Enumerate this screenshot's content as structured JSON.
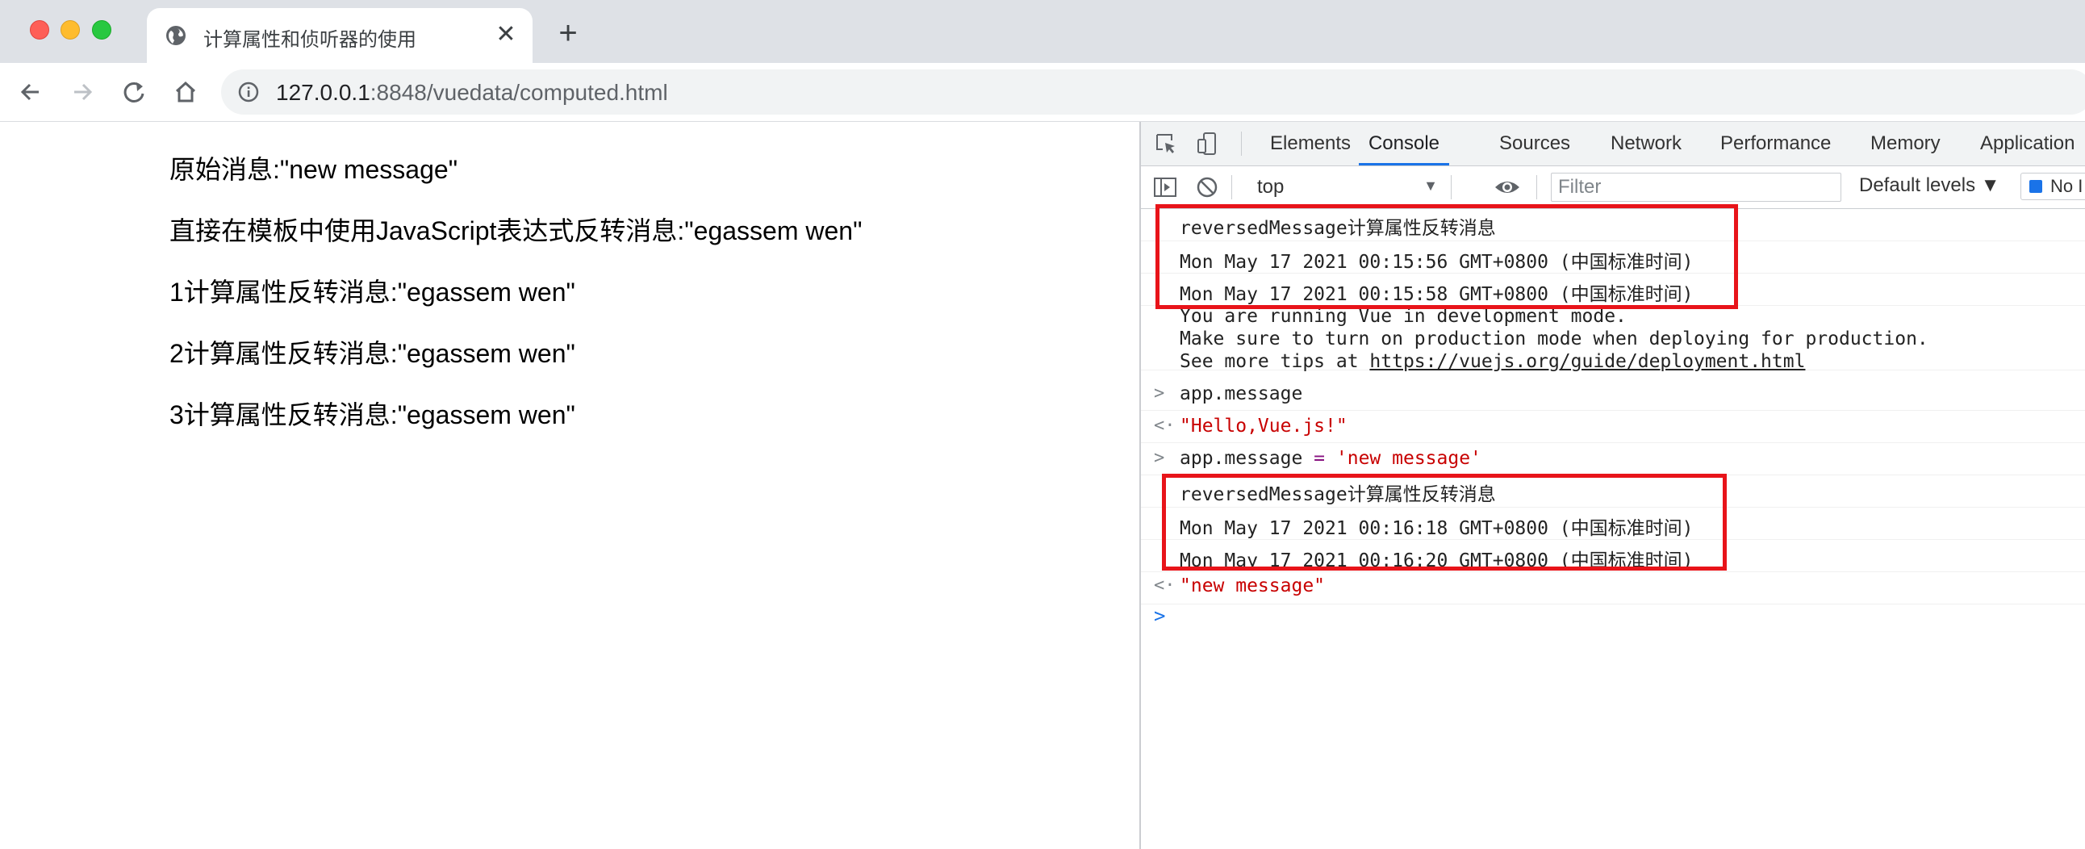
{
  "browser": {
    "tab_title": "计算属性和侦听器的使用",
    "close_glyph": "✕",
    "new_tab_glyph": "+",
    "url_host": "127.0.0.1",
    "url_rest": ":8848/vuedata/computed.html"
  },
  "page": {
    "lines": [
      "原始消息:\"new message\"",
      "直接在模板中使用JavaScript表达式反转消息:\"egassem wen\"",
      "1计算属性反转消息:\"egassem wen\"",
      "2计算属性反转消息:\"egassem wen\"",
      "3计算属性反转消息:\"egassem wen\""
    ]
  },
  "devtools": {
    "tabs": [
      "Elements",
      "Console",
      "Sources",
      "Network",
      "Performance",
      "Memory",
      "Application"
    ],
    "active_tab": "Console",
    "context": "top",
    "filter_placeholder": "Filter",
    "levels": "Default levels ▼",
    "issues": "No I",
    "console": {
      "log1": "reversedMessage计算属性反转消息",
      "log2": "Mon May 17 2021 00:15:56 GMT+0800 (中国标准时间)",
      "log3": "Mon May 17 2021 00:15:58 GMT+0800 (中国标准时间)",
      "vue_info_1": "You are running Vue in development mode.",
      "vue_info_2": "Make sure to turn on production mode when deploying for production.",
      "vue_info_3_prefix": "See more tips at ",
      "vue_info_3_link": "https://vuejs.org/guide/deployment.html",
      "input1": "app.message",
      "result1": "\"Hello,Vue.js!\"",
      "input2_prefix": "app.message ",
      "input2_op": "=",
      "input2_value": "'new message'",
      "log4": "reversedMessage计算属性反转消息",
      "log5": "Mon May 17 2021 00:16:18 GMT+0800 (中国标准时间)",
      "log6": "Mon May 17 2021 00:16:20 GMT+0800 (中国标准时间)",
      "result2": "\"new message\"",
      "input_prefix": ">",
      "result_prefix": "<·",
      "prompt": ">"
    },
    "highlight_color": "#e8141a"
  }
}
